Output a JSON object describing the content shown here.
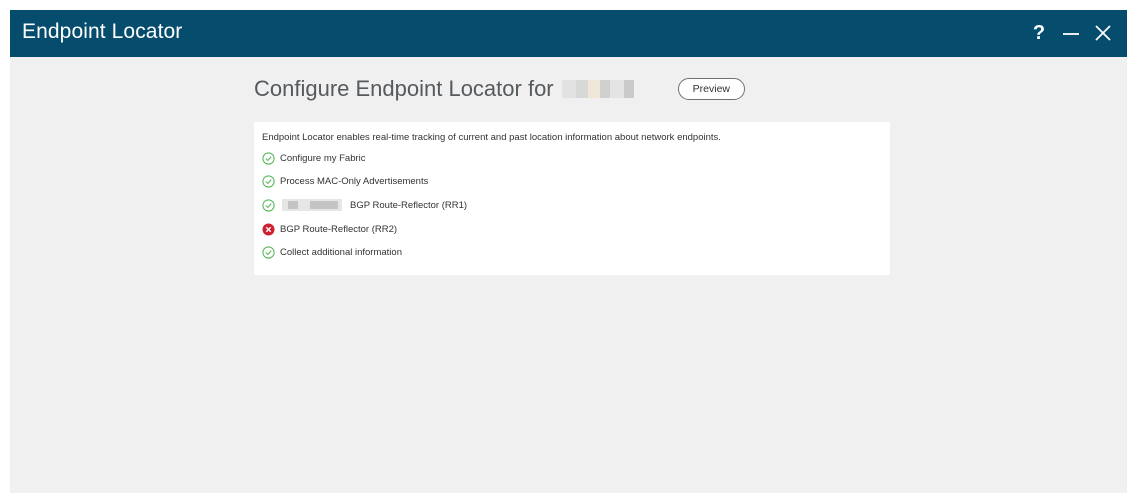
{
  "window": {
    "title": "Endpoint Locator",
    "controls": {
      "help_label": "?",
      "minimize_icon": "minimize-icon",
      "close_icon": "close-icon"
    }
  },
  "main": {
    "heading": "Configure Endpoint Locator for",
    "preview_button": "Preview",
    "description": "Endpoint Locator enables real-time tracking of current and past location information about network endpoints.",
    "steps": [
      {
        "label": "Configure my Fabric",
        "status": "success",
        "icon": "check-circle-icon"
      },
      {
        "label": "Process MAC-Only Advertisements",
        "status": "success",
        "icon": "check-circle-icon"
      },
      {
        "label": "BGP Route-Reflector (RR1)",
        "status": "success",
        "icon": "check-circle-icon"
      },
      {
        "label": "BGP Route-Reflector (RR2)",
        "status": "error",
        "icon": "error-circle-icon"
      },
      {
        "label": "Collect additional information",
        "status": "success",
        "icon": "check-circle-icon"
      }
    ]
  },
  "colors": {
    "titlebar": "#064c6d",
    "background": "#f0f0f0",
    "success": "#5cb85c",
    "error": "#cf2030"
  }
}
